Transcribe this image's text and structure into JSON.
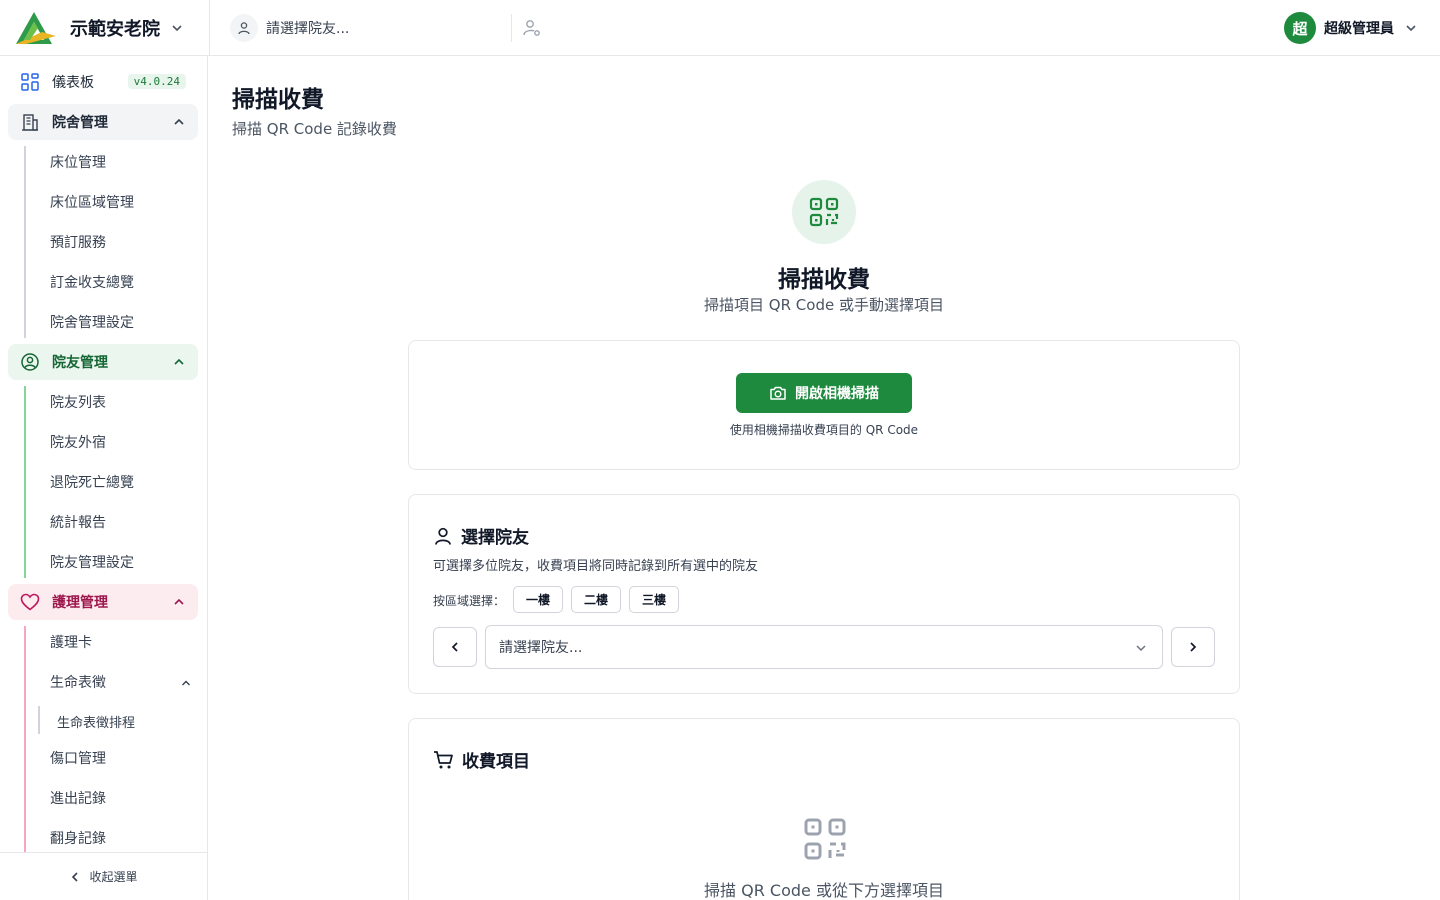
{
  "header": {
    "org_name": "示範安老院",
    "resident_placeholder": "請選擇院友...",
    "user_initial": "超",
    "user_name": "超級管理員"
  },
  "sidebar": {
    "dashboard": {
      "label": "儀表板",
      "version": "v4.0.24"
    },
    "facility": {
      "label": "院舍管理",
      "items": [
        "床位管理",
        "床位區域管理",
        "預訂服務",
        "訂金收支總覽",
        "院舍管理設定"
      ]
    },
    "residents": {
      "label": "院友管理",
      "items": [
        "院友列表",
        "院友外宿",
        "退院死亡總覽",
        "統計報告",
        "院友管理設定"
      ]
    },
    "nursing": {
      "label": "護理管理",
      "items": [
        "護理卡",
        "生命表徵",
        "生命表徵排程",
        "傷口管理",
        "進出記錄",
        "翻身記錄"
      ]
    },
    "collapse_label": "收起選單"
  },
  "page": {
    "title": "掃描收費",
    "subtitle": "掃描 QR Code 記錄收費"
  },
  "hero": {
    "title": "掃描收費",
    "subtitle": "掃描項目 QR Code 或手動選擇項目"
  },
  "camera": {
    "button_label": "開啟相機掃描",
    "hint": "使用相機掃描收費項目的 QR Code"
  },
  "select_resident": {
    "title": "選擇院友",
    "description": "可選擇多位院友，收費項目將同時記錄到所有選中的院友",
    "area_label": "按區域選擇：",
    "areas": [
      "一樓",
      "二樓",
      "三樓"
    ],
    "placeholder": "請選擇院友..."
  },
  "charge_items": {
    "title": "收費項目",
    "empty_text": "掃描 QR Code 或從下方選擇項目"
  },
  "colors": {
    "primary": "#1e8a3e",
    "residents_accent": "#166534",
    "nursing_accent": "#9d174d"
  }
}
